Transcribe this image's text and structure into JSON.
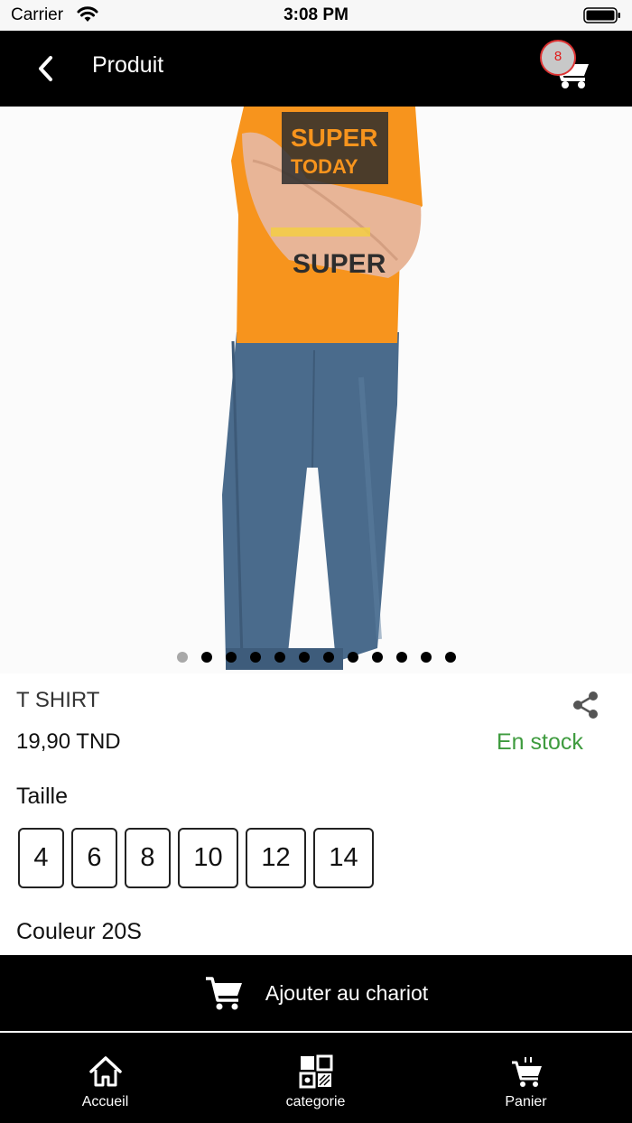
{
  "status_bar": {
    "carrier": "Carrier",
    "time": "3:08 PM"
  },
  "header": {
    "title": "Produit",
    "cart_count": "8"
  },
  "gallery": {
    "dot_count": 12,
    "active_index": 0,
    "shirt_text": [
      "SUPER",
      "TODAY",
      "SUPER"
    ],
    "colors": {
      "shirt": "#f7941d",
      "jeans": "#4a6b8c"
    }
  },
  "product": {
    "name": "T SHIRT",
    "price": "19,90 TND",
    "stock_status": "En stock",
    "size_label": "Taille",
    "sizes": [
      "4",
      "6",
      "8",
      "10",
      "12",
      "14"
    ],
    "color_label": "Couleur 20S"
  },
  "add_to_cart": {
    "label": "Ajouter au chariot"
  },
  "tabs": [
    {
      "label": "Accueil",
      "icon": "home-icon"
    },
    {
      "label": "categorie",
      "icon": "category-icon"
    },
    {
      "label": "Panier",
      "icon": "cart-icon"
    }
  ],
  "colors": {
    "stock_green": "#3e9b3e",
    "badge_red": "#e01b1b",
    "bar_black": "#000000"
  }
}
